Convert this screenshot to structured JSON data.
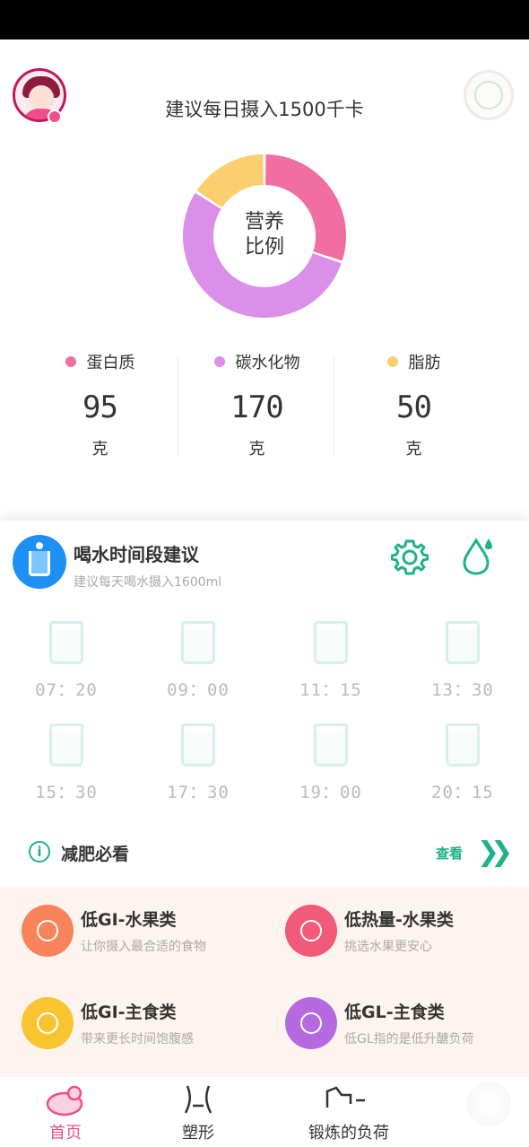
{
  "header": {
    "daily_recommendation": "建议每日摄入1500千卡"
  },
  "donut": {
    "center_line1": "营养",
    "center_line2": "比例"
  },
  "chart_data": {
    "type": "pie",
    "donut": true,
    "slices": [
      {
        "label": "蛋白质",
        "value": 95,
        "color": "#f06fa0"
      },
      {
        "label": "碳水化物",
        "value": 170,
        "color": "#da8fe9"
      },
      {
        "label": "脂肪",
        "value": 50,
        "color": "#fbcf6f"
      }
    ]
  },
  "macros": [
    {
      "label": "蛋白质",
      "value": "95",
      "unit": "克",
      "color": "#f06fa0"
    },
    {
      "label": "碳水化物",
      "value": "170",
      "unit": "克",
      "color": "#da8fe9"
    },
    {
      "label": "脂肪",
      "value": "50",
      "unit": "克",
      "color": "#fbcf6f"
    }
  ],
  "water": {
    "title": "喝水时间段建议",
    "subtitle": "建议每天喝水摄入1600ml",
    "times": [
      "07：20",
      "09：00",
      "11：15",
      "13：30",
      "15：30",
      "17：30",
      "19：00",
      "20：15"
    ]
  },
  "must_read": {
    "title": "减肥必看",
    "more": "查看",
    "chevron": "❯❯"
  },
  "cards": [
    {
      "title": "低GI-水果类",
      "subtitle": "让你摄入最合适的食物",
      "color": "#f9835a",
      "icon": "fruit-icon"
    },
    {
      "title": "低热量-水果类",
      "subtitle": "挑选水果更安心",
      "color": "#f25a7a",
      "icon": "apple-icon"
    },
    {
      "title": "低GI-主食类",
      "subtitle": "带来更长时间饱腹感",
      "color": "#f8c531",
      "icon": "rice-bowl-icon"
    },
    {
      "title": "低GL-主食类",
      "subtitle": "低GL指的是低升醣负荷",
      "color": "#b56ae0",
      "icon": "salad-icon"
    }
  ],
  "tabs": [
    {
      "label": "首页",
      "icon": "home-icon",
      "active": true
    },
    {
      "label": "塑形",
      "icon": "waist-icon",
      "active": false
    },
    {
      "label": "锻炼的负荷",
      "icon": "exercise-icon",
      "active": false
    }
  ],
  "colors": {
    "accent": "#1fb28a",
    "brand": "#ec4f89"
  }
}
